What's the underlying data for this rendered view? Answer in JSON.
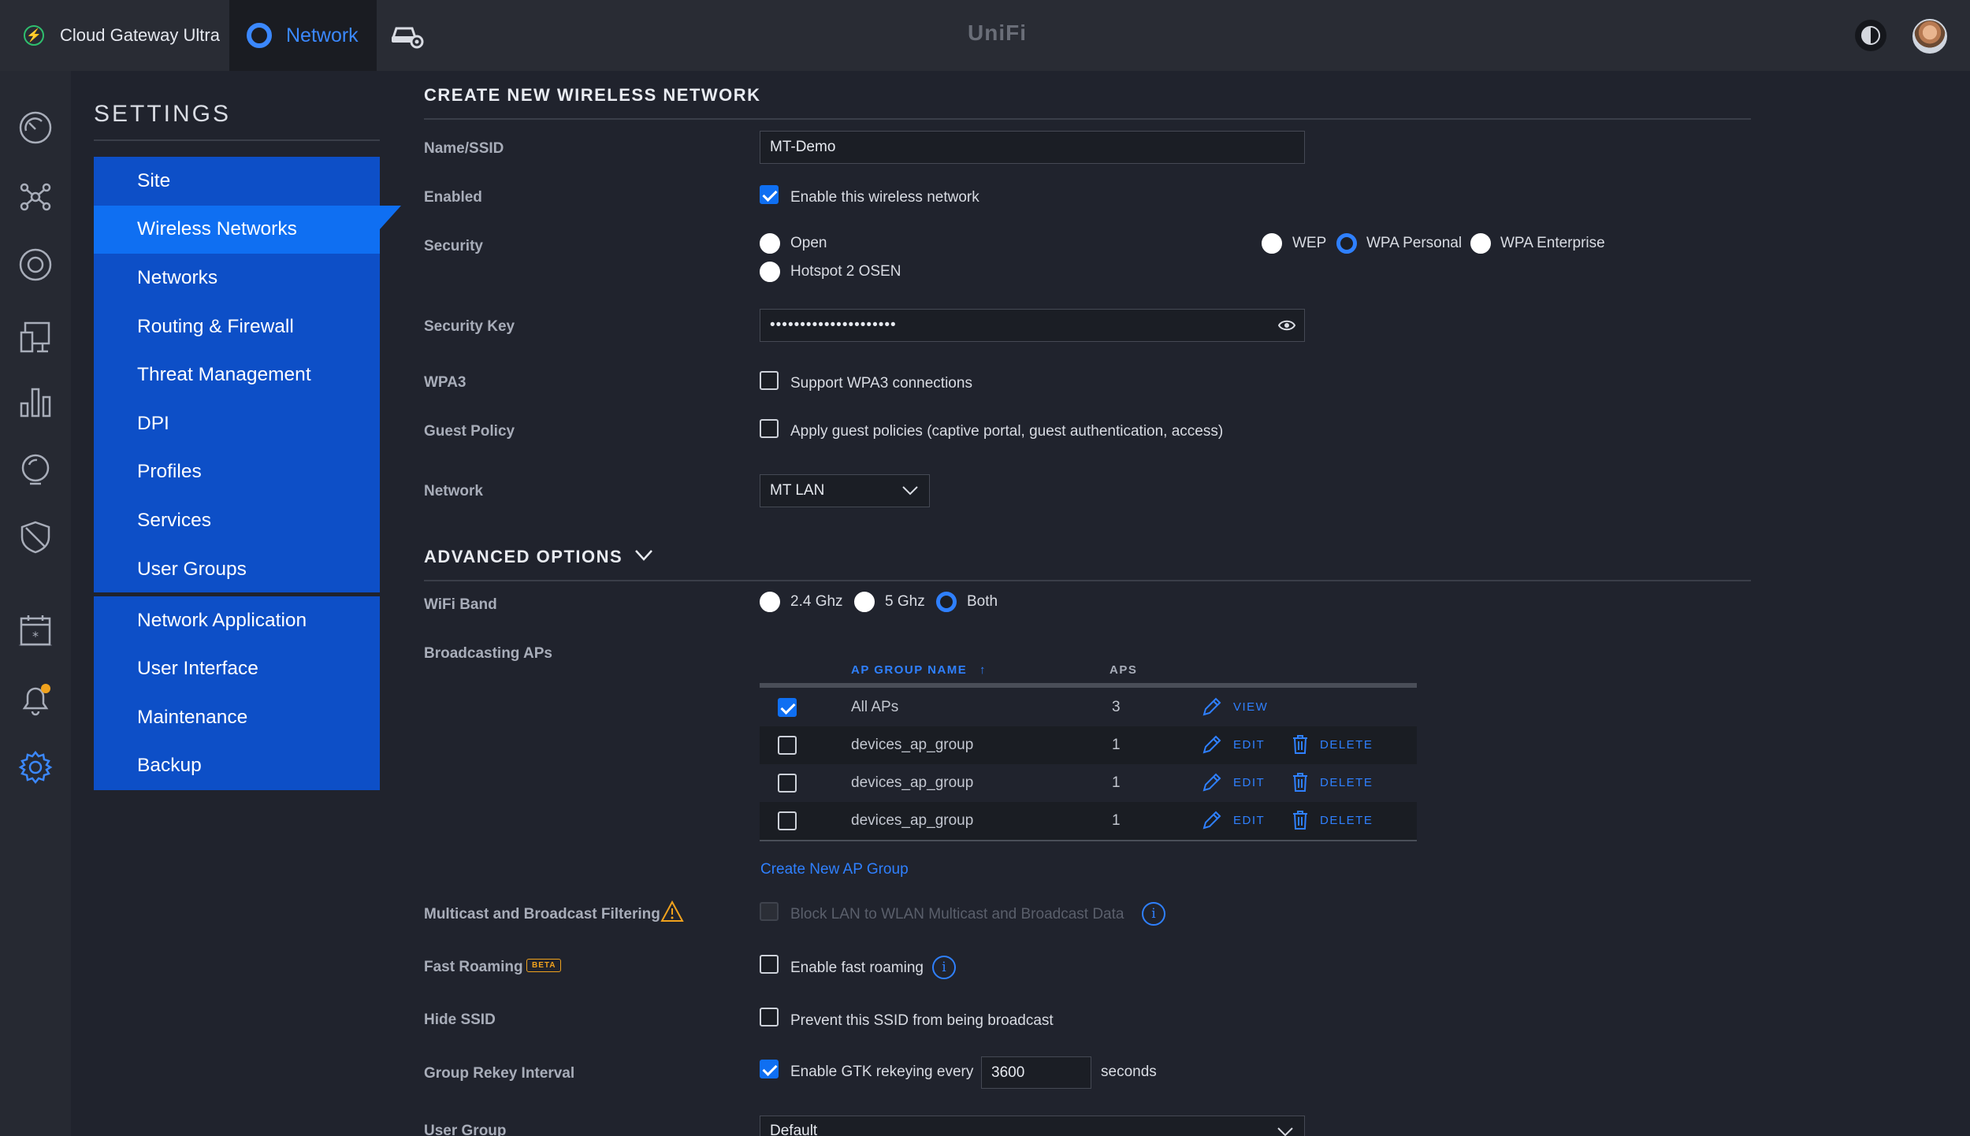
{
  "topbar": {
    "gateway_name": "Cloud Gateway Ultra",
    "app_tab": "Network",
    "brand": "UniFi",
    "accent_color": "#3b88ff"
  },
  "rail": {
    "icons": [
      "dashboard-icon",
      "topology-icon",
      "devices-icon",
      "clients-icon",
      "statistics-icon",
      "insights-icon",
      "security-icon",
      "events-icon",
      "alerts-icon",
      "settings-icon"
    ]
  },
  "sidebar": {
    "title": "SETTINGS",
    "group1": [
      {
        "label": "Site"
      },
      {
        "label": "Wireless Networks",
        "active": true
      },
      {
        "label": "Networks"
      },
      {
        "label": "Routing & Firewall"
      },
      {
        "label": "Threat Management"
      },
      {
        "label": "DPI"
      },
      {
        "label": "Profiles"
      },
      {
        "label": "Services"
      },
      {
        "label": "User Groups"
      }
    ],
    "group2": [
      {
        "label": "Network Application"
      },
      {
        "label": "User Interface"
      },
      {
        "label": "Maintenance"
      },
      {
        "label": "Backup"
      }
    ]
  },
  "form": {
    "title": "CREATE NEW WIRELESS NETWORK",
    "ssid": {
      "label": "Name/SSID",
      "value": "MT-Demo"
    },
    "enabled": {
      "label": "Enabled",
      "option": "Enable this wireless network",
      "checked": true
    },
    "security": {
      "label": "Security",
      "options": [
        "Open",
        "WEP",
        "WPA Personal",
        "WPA Enterprise",
        "Hotspot 2 OSEN"
      ],
      "selected": "WPA Personal"
    },
    "security_key": {
      "label": "Security Key",
      "value": "•••••••••••••••••••••"
    },
    "wpa3": {
      "label": "WPA3",
      "option": "Support WPA3 connections",
      "checked": false
    },
    "guest_policy": {
      "label": "Guest Policy",
      "option": "Apply guest policies (captive portal, guest authentication, access)",
      "checked": false
    },
    "network": {
      "label": "Network",
      "value": "MT LAN"
    },
    "advanced_title": "ADVANCED OPTIONS",
    "wifi_band": {
      "label": "WiFi Band",
      "options": [
        "2.4 Ghz",
        "5 Ghz",
        "Both"
      ],
      "selected": "Both"
    },
    "broadcasting": {
      "label": "Broadcasting APs",
      "col_name": "AP GROUP NAME",
      "col_aps": "APS",
      "rows": [
        {
          "name": "All APs",
          "aps": "3",
          "checked": true,
          "edit": "VIEW",
          "delete": ""
        },
        {
          "name": "devices_ap_group",
          "aps": "1",
          "checked": false,
          "edit": "EDIT",
          "delete": "DELETE"
        },
        {
          "name": "devices_ap_group",
          "aps": "1",
          "checked": false,
          "edit": "EDIT",
          "delete": "DELETE"
        },
        {
          "name": "devices_ap_group",
          "aps": "1",
          "checked": false,
          "edit": "EDIT",
          "delete": "DELETE"
        }
      ],
      "create_link": "Create New AP Group"
    },
    "multicast": {
      "label": "Multicast and Broadcast Filtering",
      "option": "Block LAN to WLAN Multicast and Broadcast Data",
      "checked": false
    },
    "fast_roaming": {
      "label": "Fast Roaming",
      "badge": "BETA",
      "option": "Enable fast roaming",
      "checked": false
    },
    "hide_ssid": {
      "label": "Hide SSID",
      "option": "Prevent this SSID from being broadcast",
      "checked": false
    },
    "rekey": {
      "label": "Group Rekey Interval",
      "option": "Enable GTK rekeying every",
      "value": "3600",
      "unit": "seconds",
      "checked": true
    },
    "user_group": {
      "label": "User Group",
      "value": "Default"
    }
  }
}
